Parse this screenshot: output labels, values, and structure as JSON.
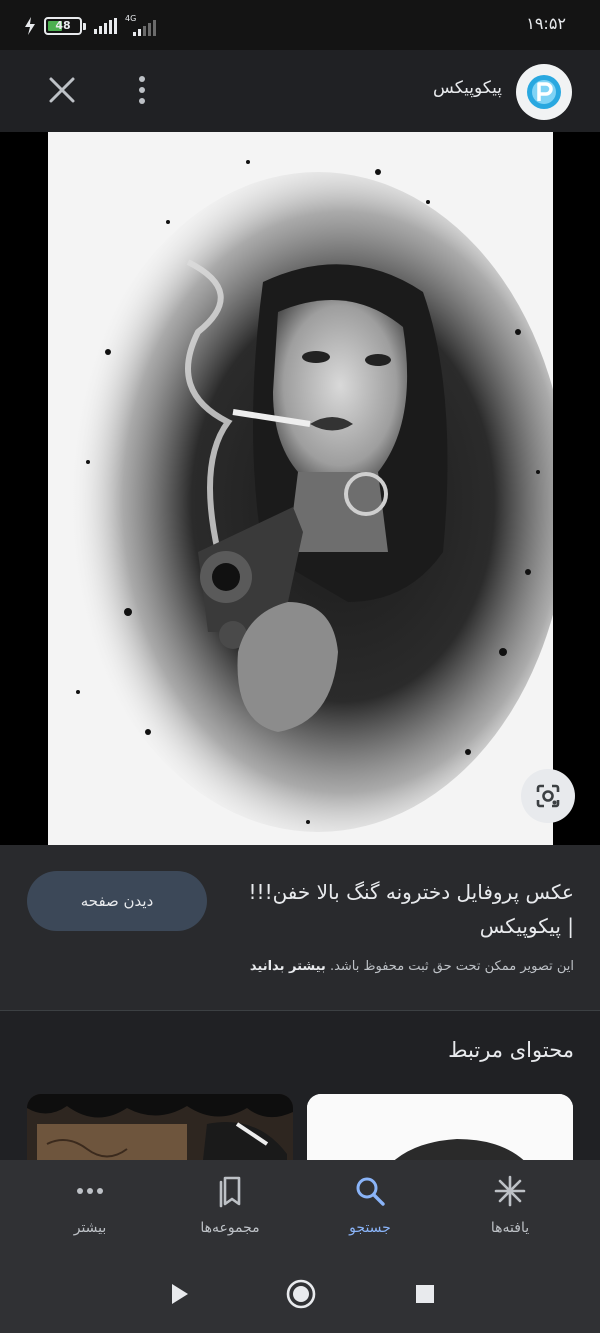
{
  "status_bar": {
    "battery": "48",
    "battery_level": 0.48,
    "network": "4G",
    "time": "۱۹:۵۲"
  },
  "header": {
    "site_name": "پیکوپیکس",
    "logo_icon": "picopix-logo-icon",
    "close_icon": "close-icon",
    "menu_icon": "more-vert-icon"
  },
  "viewer": {
    "lens_icon": "google-lens-icon"
  },
  "info": {
    "visit_label": "دیدن صفحه",
    "title": "عکس پروفایل دخترونه گنگ بالا خفن!!! | پیکوپیکس",
    "copyright_text": "این تصویر ممکن تحت حق ثبت محفوظ باشد.",
    "learn_more": "بیشتر بدانید"
  },
  "related": {
    "title": "محتوای مرتبط"
  },
  "bottom_nav": {
    "items": [
      {
        "label": "یافته‌ها",
        "icon": "asterisk-icon"
      },
      {
        "label": "جستجو",
        "icon": "search-icon",
        "active": true
      },
      {
        "label": "مجموعه‌ها",
        "icon": "bookmarks-icon"
      },
      {
        "label": "بیشتر",
        "icon": "more-horiz-icon"
      }
    ]
  },
  "colors": {
    "background": "#202124",
    "panel": "#292a2d",
    "accent": "#8ab4f8",
    "button": "#3c4858"
  }
}
